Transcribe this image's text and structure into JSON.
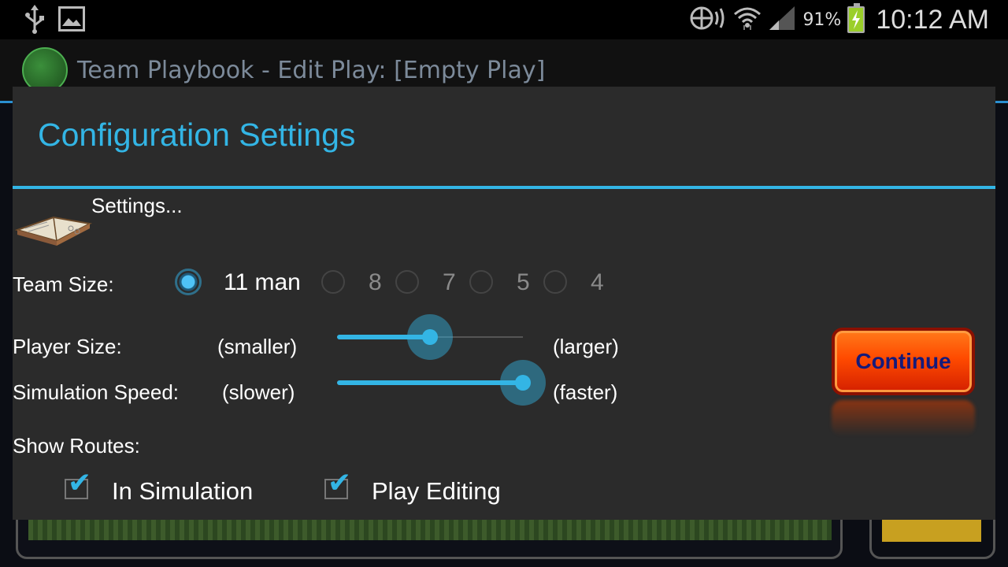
{
  "status_bar": {
    "battery_percent": "91%",
    "time": "10:12 AM",
    "icons": [
      "usb-icon",
      "image-icon",
      "nfc-icon",
      "wifi-icon",
      "signal-icon",
      "battery-icon"
    ]
  },
  "app": {
    "title": "Team Playbook - Edit Play:  [Empty Play]"
  },
  "dialog": {
    "title": "Configuration Settings",
    "settings_label": "Settings...",
    "team_size": {
      "label": "Team Size:",
      "options": [
        {
          "label": "11 man",
          "selected": true
        },
        {
          "label": "8",
          "selected": false
        },
        {
          "label": "7",
          "selected": false
        },
        {
          "label": "5",
          "selected": false
        },
        {
          "label": "4",
          "selected": false
        }
      ]
    },
    "player_size": {
      "label": "Player Size:",
      "min_label": "(smaller)",
      "max_label": "(larger)",
      "value": 0.5
    },
    "simulation_speed": {
      "label": "Simulation Speed:",
      "min_label": "(slower)",
      "max_label": "(faster)",
      "value": 1.0
    },
    "show_routes": {
      "label": "Show Routes:",
      "in_simulation": {
        "label": "In Simulation",
        "checked": true
      },
      "play_editing": {
        "label": "Play Editing",
        "checked": true
      }
    },
    "continue_label": "Continue",
    "accent_color": "#33b5e5",
    "button_color": "#ff4a00"
  }
}
